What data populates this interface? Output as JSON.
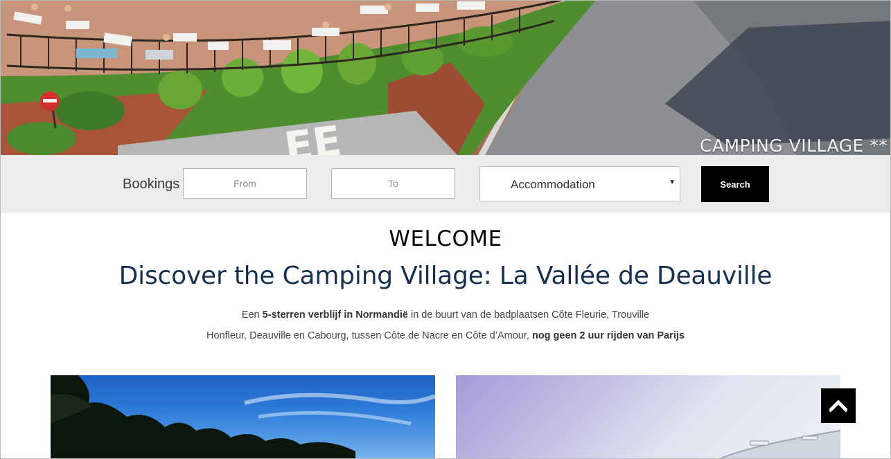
{
  "hero": {
    "caption": "CAMPING VILLAGE **"
  },
  "booking": {
    "label": "Bookings",
    "from_placeholder": "From",
    "to_placeholder": "To",
    "accommodation_value": "Accommodation",
    "search_label": "Search"
  },
  "welcome": {
    "heading": "WELCOME",
    "title": "Discover the Camping Village: La Vallée de Deauville",
    "line1_a": "Een ",
    "line1_b": "5-sterren verblijf in Normandië",
    "line1_c": " in de buurt van de badplaatsen Côte Fleurie, Trouville",
    "line2_a": "Honfleur, Deauville en Cabourg, tussen Côte de Nacre en Côte d’Amour,",
    "line2_b": "nog geen 2 uur rijden van Parijs"
  },
  "icons": {
    "back_to_top": "chevron-up-icon",
    "select_arrow": "caret-down-icon"
  },
  "colors": {
    "title": "#163050",
    "booking_bar": "#ececec",
    "search_button": "#000000"
  }
}
